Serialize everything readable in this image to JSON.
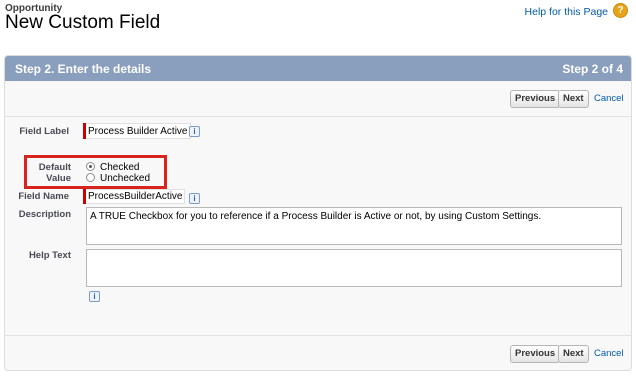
{
  "header": {
    "object_name": "Opportunity",
    "page_title": "New Custom Field",
    "help_link": "Help for this Page",
    "help_icon": "?"
  },
  "panel": {
    "step_title": "Step 2. Enter the details",
    "step_counter": "Step 2 of 4"
  },
  "buttons": {
    "previous": "Previous",
    "next": "Next",
    "cancel": "Cancel"
  },
  "form": {
    "field_label": {
      "label": "Field Label",
      "value": "Process Builder Active"
    },
    "default_value": {
      "label_line1": "Default",
      "label_line2": "Value",
      "options": [
        {
          "label": "Checked",
          "selected": true
        },
        {
          "label": "Unchecked",
          "selected": false
        }
      ]
    },
    "field_name": {
      "label": "Field Name",
      "value": "ProcessBuilderActive"
    },
    "description": {
      "label": "Description",
      "value": "A TRUE Checkbox for you to reference if a Process Builder is Active or not, by using Custom Settings."
    },
    "help_text": {
      "label": "Help Text",
      "value": ""
    },
    "info_icon": "i"
  },
  "colors": {
    "panel_bar": "#8a9ebe",
    "required_marker": "#cc0000",
    "highlight_box": "#d8231f",
    "link": "#015ba7"
  }
}
